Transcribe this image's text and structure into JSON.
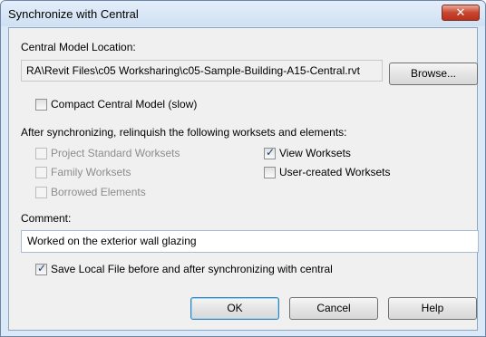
{
  "window": {
    "title": "Synchronize with Central",
    "close_glyph": "✕"
  },
  "central": {
    "label": "Central Model Location:",
    "path": "RA\\Revit Files\\c05 Worksharing\\c05-Sample-Building-A15-Central.rvt",
    "browse_label": "Browse..."
  },
  "compact": {
    "label": "Compact Central Model (slow)",
    "checked": false
  },
  "relinquish": {
    "heading": "After synchronizing, relinquish the following worksets and elements:",
    "project_standard": {
      "label": "Project Standard Worksets",
      "checked": false,
      "enabled": false
    },
    "family": {
      "label": "Family Worksets",
      "checked": false,
      "enabled": false
    },
    "borrowed": {
      "label": "Borrowed Elements",
      "checked": false,
      "enabled": false
    },
    "view": {
      "label": "View Worksets",
      "checked": true,
      "enabled": true
    },
    "user_created": {
      "label": "User-created Worksets",
      "checked": false,
      "enabled": true
    }
  },
  "comment": {
    "label": "Comment:",
    "value": "Worked on the exterior wall glazing"
  },
  "save_local": {
    "label": "Save Local File before and after synchronizing with central",
    "checked": true
  },
  "buttons": {
    "ok": "OK",
    "cancel": "Cancel",
    "help": "Help"
  },
  "checkmark_glyph": "✓"
}
